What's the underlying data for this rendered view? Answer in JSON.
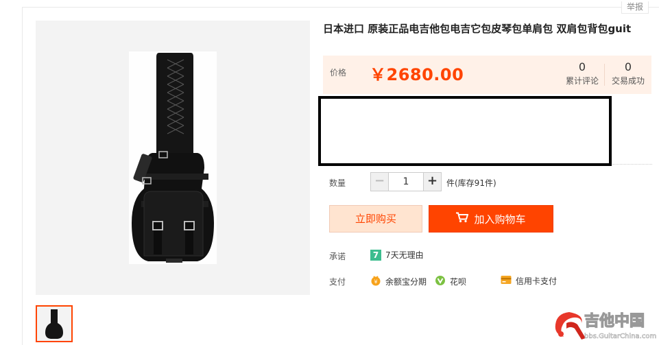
{
  "header": {
    "report_label": "举报"
  },
  "product": {
    "title": "日本进口 原装正品电吉他包电吉它包皮琴包单肩包 双肩包背包guit"
  },
  "price": {
    "label": "价格",
    "value": "￥2680.00",
    "stats": [
      {
        "count": "0",
        "label": "累计评论"
      },
      {
        "count": "0",
        "label": "交易成功"
      }
    ]
  },
  "quantity": {
    "label": "数量",
    "minus": "−",
    "value": "1",
    "plus": "+",
    "stock_note": "件(库存91件)"
  },
  "actions": {
    "buy_now": "立即购买",
    "add_to_cart": "加入购物车"
  },
  "promise": {
    "label": "承诺",
    "icon_text": "7",
    "text": "7天无理由"
  },
  "payment": {
    "label": "支付",
    "options": [
      {
        "icon": "yuebao-icon",
        "text": "余额宝分期"
      },
      {
        "icon": "huabei-icon",
        "text": "花呗"
      },
      {
        "icon": "credit-card-icon",
        "text": "信用卡支付"
      }
    ]
  },
  "watermark": {
    "brand": "吉他中国",
    "url": "bbs.GuitarChina.com"
  },
  "colors": {
    "accent": "#ff4400",
    "price_bg": "#fff1e8",
    "buy_bg": "#ffe4d0",
    "seven_day_green": "#3dbd8f"
  }
}
